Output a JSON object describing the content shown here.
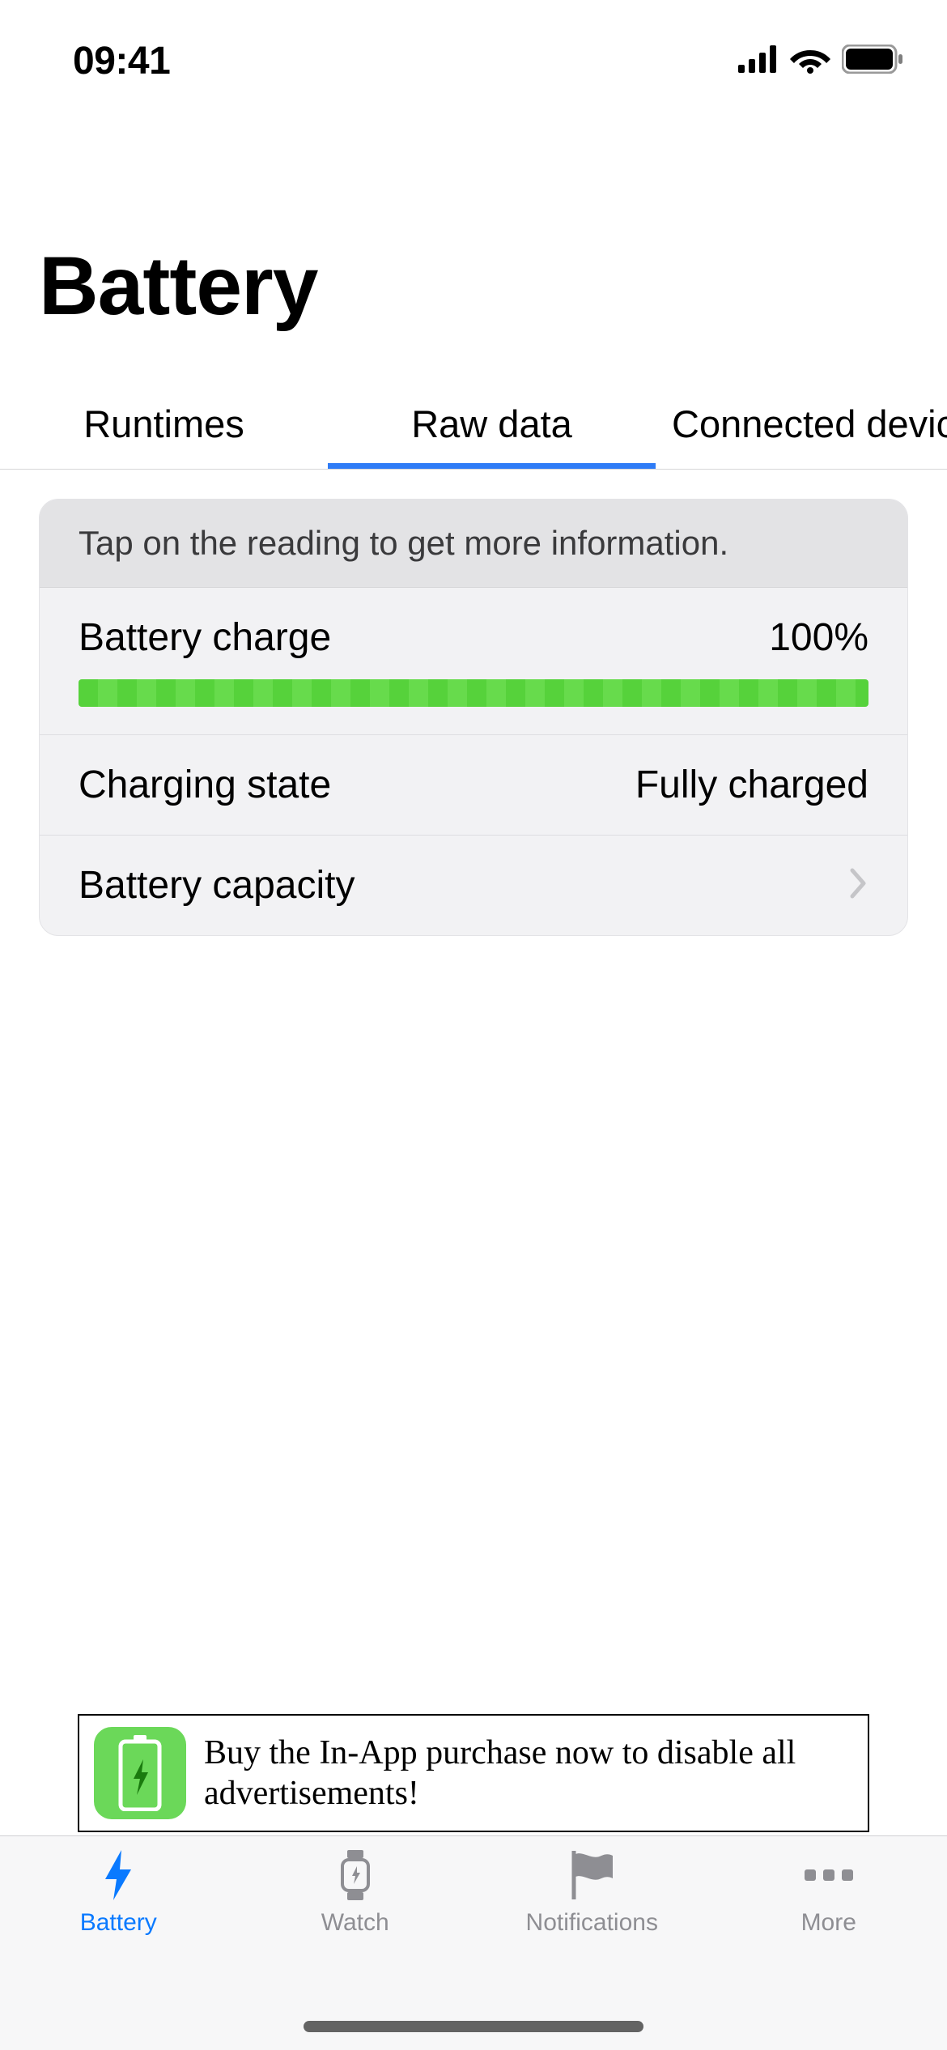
{
  "status": {
    "time": "09:41"
  },
  "header": {
    "title": "Battery"
  },
  "tabs": {
    "items": [
      {
        "label": "Runtimes",
        "active": false
      },
      {
        "label": "Raw data",
        "active": true
      },
      {
        "label": "Connected device",
        "active": false
      }
    ]
  },
  "hint": "Tap on the reading to get more information.",
  "rows": {
    "charge": {
      "label": "Battery charge",
      "value": "100%",
      "percent": 100
    },
    "state": {
      "label": "Charging state",
      "value": "Fully charged"
    },
    "capacity": {
      "label": "Battery capacity"
    }
  },
  "ad": {
    "text": "Buy the In-App purchase now to disable all advertisements!"
  },
  "tabbar": {
    "items": [
      {
        "label": "Battery"
      },
      {
        "label": "Watch"
      },
      {
        "label": "Notifications"
      },
      {
        "label": "More"
      }
    ],
    "active_index": 0
  }
}
